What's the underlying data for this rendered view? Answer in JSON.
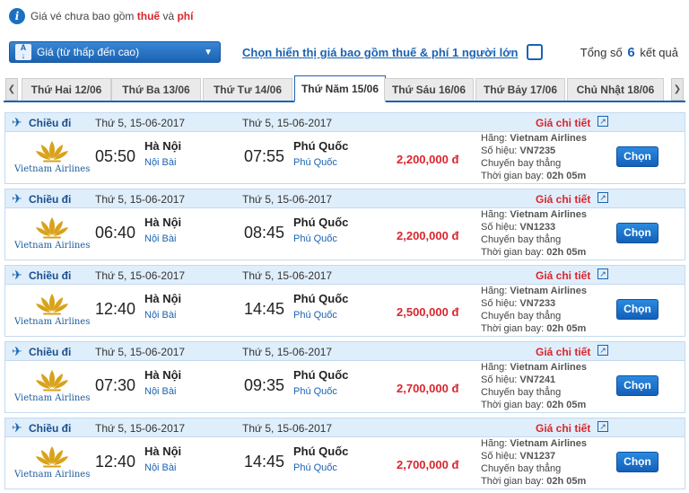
{
  "notice": {
    "prefix": "Giá vé chưa bao gồm ",
    "tax": "thuế",
    "and": " và ",
    "fee": "phí"
  },
  "sort": {
    "selected": "Giá (từ thấp đến cao)"
  },
  "tax_toggle": {
    "label": "Chọn hiển thị giá bao gồm thuế & phí 1 người lớn",
    "checked": false
  },
  "total": {
    "prefix": "Tổng số",
    "count": "6",
    "suffix": "kết quả"
  },
  "dates": [
    {
      "label": "Thứ Hai 12/06",
      "active": false
    },
    {
      "label": "Thứ Ba 13/06",
      "active": false
    },
    {
      "label": "Thứ Tư 14/06",
      "active": false
    },
    {
      "label": "Thứ Năm 15/06",
      "active": true
    },
    {
      "label": "Thứ Sáu 16/06",
      "active": false
    },
    {
      "label": "Thứ Bảy 17/06",
      "active": false
    },
    {
      "label": "Chủ Nhật 18/06",
      "active": false
    }
  ],
  "date_arrows": {
    "prev": "❮",
    "next": "❯"
  },
  "labels": {
    "direction": "Chiều đi",
    "detail": "Giá chi tiết",
    "airline_prefix": "Hãng: ",
    "flight_prefix": "Số hiệu: ",
    "duration_prefix": "Thời gian bay: ",
    "choose": "Chọn",
    "logo_text": "Vietnam Airlines"
  },
  "flights": [
    {
      "date_from": "Thứ 5, 15-06-2017",
      "date_to": "Thứ 5, 15-06-2017",
      "dep_time": "05:50",
      "dep_city": "Hà Nội",
      "dep_airport": "Nội Bài",
      "arr_time": "07:55",
      "arr_city": "Phú Quốc",
      "arr_airport": "Phú Quốc",
      "price": "2,200,000 đ",
      "airline": "Vietnam Airlines",
      "flight_no": "VN7235",
      "type": "Chuyến bay thẳng",
      "duration": "02h 05m"
    },
    {
      "date_from": "Thứ 5, 15-06-2017",
      "date_to": "Thứ 5, 15-06-2017",
      "dep_time": "06:40",
      "dep_city": "Hà Nội",
      "dep_airport": "Nội Bài",
      "arr_time": "08:45",
      "arr_city": "Phú Quốc",
      "arr_airport": "Phú Quốc",
      "price": "2,200,000 đ",
      "airline": "Vietnam Airlines",
      "flight_no": "VN1233",
      "type": "Chuyến bay thẳng",
      "duration": "02h 05m"
    },
    {
      "date_from": "Thứ 5, 15-06-2017",
      "date_to": "Thứ 5, 15-06-2017",
      "dep_time": "12:40",
      "dep_city": "Hà Nội",
      "dep_airport": "Nội Bài",
      "arr_time": "14:45",
      "arr_city": "Phú Quốc",
      "arr_airport": "Phú Quốc",
      "price": "2,500,000 đ",
      "airline": "Vietnam Airlines",
      "flight_no": "VN7233",
      "type": "Chuyến bay thẳng",
      "duration": "02h 05m"
    },
    {
      "date_from": "Thứ 5, 15-06-2017",
      "date_to": "Thứ 5, 15-06-2017",
      "dep_time": "07:30",
      "dep_city": "Hà Nội",
      "dep_airport": "Nội Bài",
      "arr_time": "09:35",
      "arr_city": "Phú Quốc",
      "arr_airport": "Phú Quốc",
      "price": "2,700,000 đ",
      "airline": "Vietnam Airlines",
      "flight_no": "VN7241",
      "type": "Chuyến bay thẳng",
      "duration": "02h 05m"
    },
    {
      "date_from": "Thứ 5, 15-06-2017",
      "date_to": "Thứ 5, 15-06-2017",
      "dep_time": "12:40",
      "dep_city": "Hà Nội",
      "dep_airport": "Nội Bài",
      "arr_time": "14:45",
      "arr_city": "Phú Quốc",
      "arr_airport": "Phú Quốc",
      "price": "2,700,000 đ",
      "airline": "Vietnam Airlines",
      "flight_no": "VN1237",
      "type": "Chuyến bay thẳng",
      "duration": "02h 05m"
    }
  ],
  "colors": {
    "accent": "#1a63b3",
    "price": "#d9262e",
    "header_bg": "#dfeefb",
    "logo_gold": "#d9a21b"
  }
}
